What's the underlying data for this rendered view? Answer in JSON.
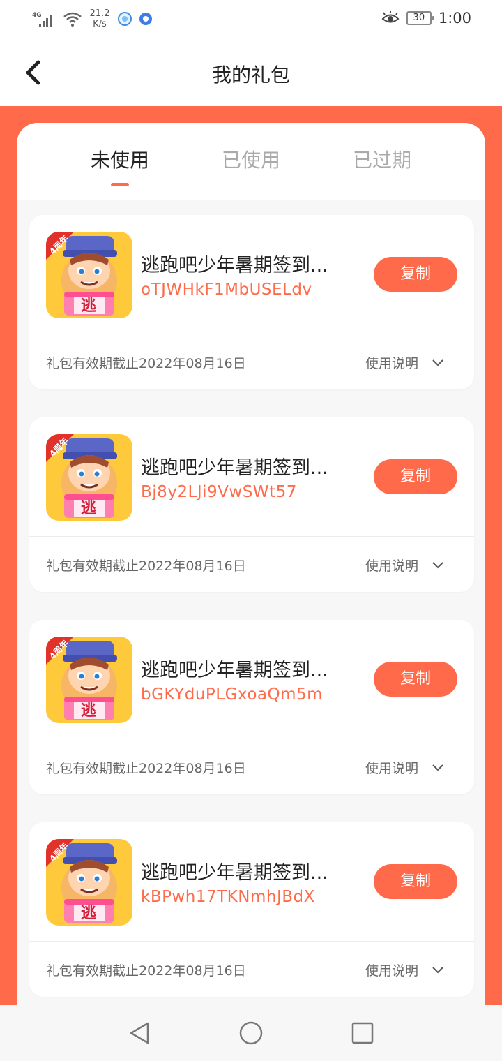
{
  "status_bar": {
    "network_tag": "4G",
    "speed_value": "21.2",
    "speed_unit": "K/s",
    "battery": "30",
    "time": "1:00"
  },
  "nav": {
    "title": "我的礼包",
    "back_icon": "chevron-left-icon"
  },
  "tabs": [
    {
      "label": "未使用",
      "active": true
    },
    {
      "label": "已使用",
      "active": false
    },
    {
      "label": "已过期",
      "active": false
    }
  ],
  "gifts": [
    {
      "name": "逃跑吧少年暑期签到...",
      "code": "oTJWHkF1MbUSELdv",
      "copy_label": "复制",
      "expiry": "礼包有效期截止2022年08月16日",
      "usage_label": "使用说明",
      "icon_badge": "4周年",
      "icon_char": "逃"
    },
    {
      "name": "逃跑吧少年暑期签到...",
      "code": "Bj8y2LJi9VwSWt57",
      "copy_label": "复制",
      "expiry": "礼包有效期截止2022年08月16日",
      "usage_label": "使用说明",
      "icon_badge": "4周年",
      "icon_char": "逃"
    },
    {
      "name": "逃跑吧少年暑期签到...",
      "code": "bGKYduPLGxoaQm5m",
      "copy_label": "复制",
      "expiry": "礼包有效期截止2022年08月16日",
      "usage_label": "使用说明",
      "icon_badge": "4周年",
      "icon_char": "逃"
    },
    {
      "name": "逃跑吧少年暑期签到...",
      "code": "kBPwh17TKNmhJBdX",
      "copy_label": "复制",
      "expiry": "礼包有效期截止2022年08月16日",
      "usage_label": "使用说明",
      "icon_badge": "4周年",
      "icon_char": "逃"
    }
  ],
  "system_nav": [
    "back-triangle-icon",
    "home-circle-icon",
    "recents-square-icon"
  ],
  "colors": {
    "accent": "#ff6b4a",
    "active_tab": "#222222",
    "inactive_tab": "#aaaaaa"
  }
}
